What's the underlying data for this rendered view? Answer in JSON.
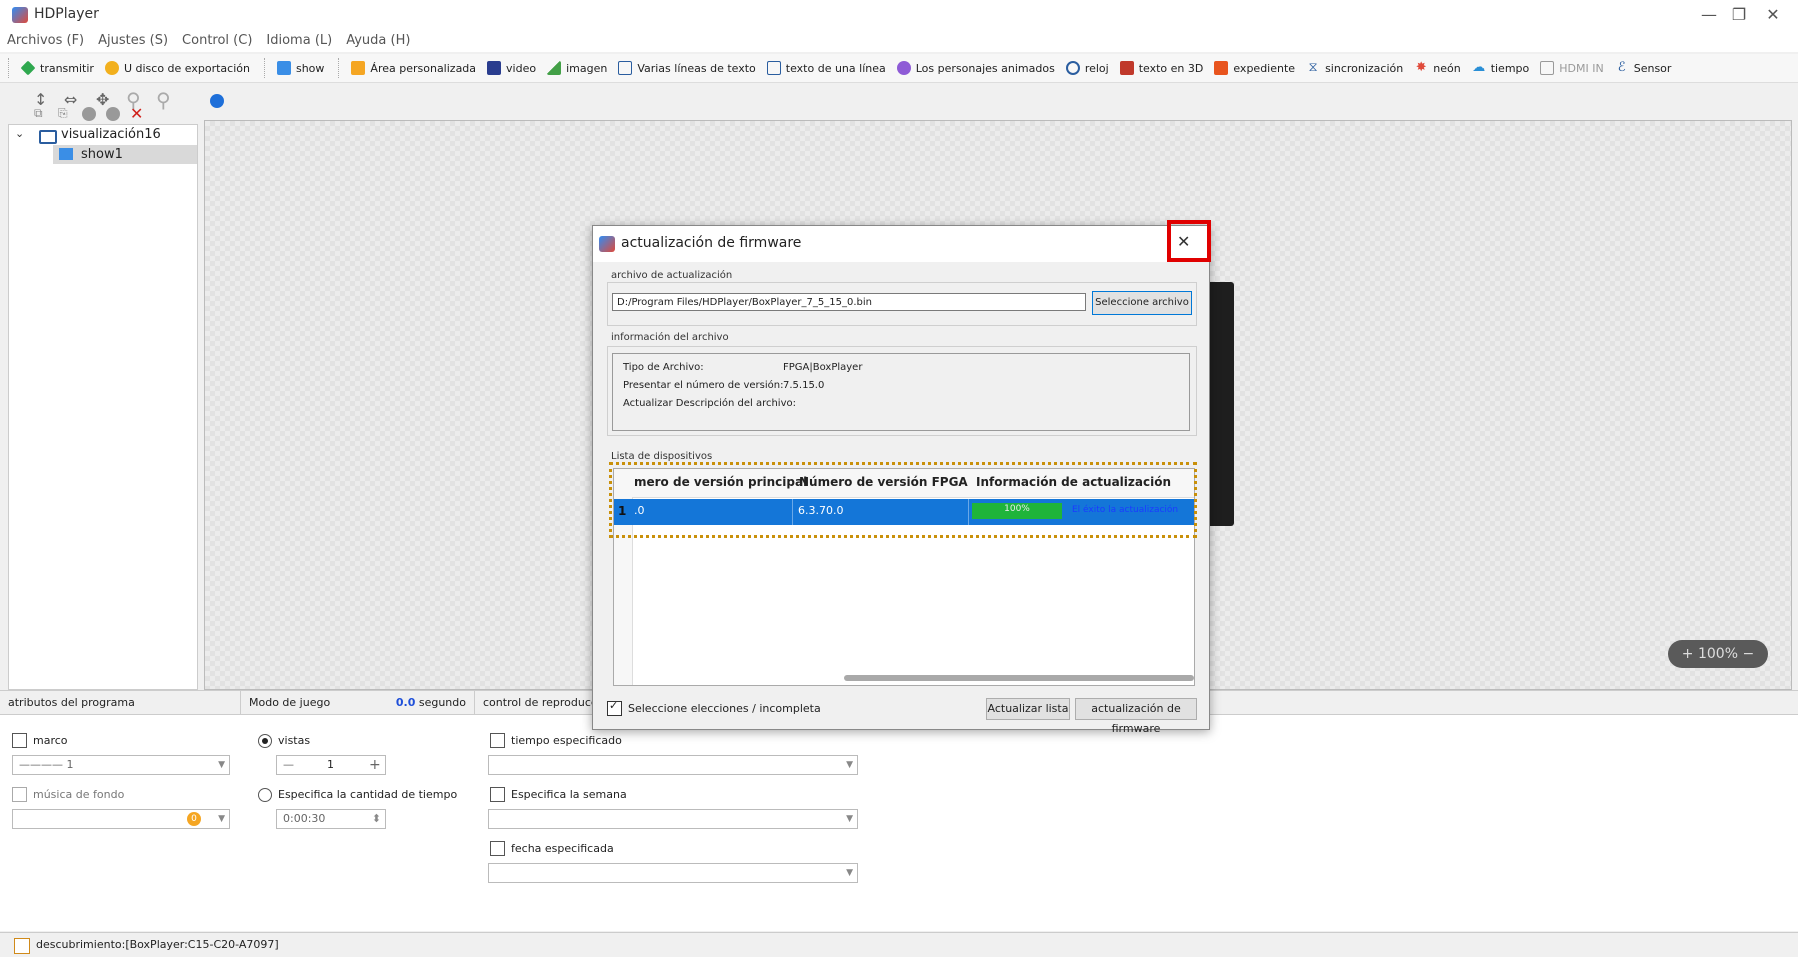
{
  "window": {
    "title": "HDPlayer"
  },
  "menu": [
    "Archivos (F)",
    "Ajustes (S)",
    "Control (C)",
    "Idioma (L)",
    "Ayuda (H)"
  ],
  "toolbar1": {
    "group1": [
      {
        "label": "transmitir",
        "icon": "diamond-icon",
        "color": "#2fa84f"
      },
      {
        "label": "U disco de exportación",
        "icon": "usb-icon",
        "color": "#f2b01e"
      }
    ],
    "group2": [
      {
        "label": "show",
        "icon": "show-icon",
        "color": "#3a8ee6"
      }
    ],
    "group3": [
      {
        "label": "Área personalizada",
        "icon": "area-icon",
        "color": "#f5a623"
      },
      {
        "label": "video",
        "icon": "film-icon",
        "color": "#2a3d8f"
      },
      {
        "label": "imagen",
        "icon": "image-icon",
        "color": "#43a047"
      },
      {
        "label": "Varias líneas de texto",
        "icon": "multiline-text-icon",
        "color": "#2a5d9f"
      },
      {
        "label": "texto de una línea",
        "icon": "singleline-text-icon",
        "color": "#2a5d9f"
      },
      {
        "label": "Los personajes animados",
        "icon": "animated-icon",
        "color": "#8e5bd6"
      },
      {
        "label": "reloj",
        "icon": "clock-icon",
        "color": "#2a5d9f"
      },
      {
        "label": "texto en 3D",
        "icon": "text3d-icon",
        "color": "#c0392b"
      },
      {
        "label": "expediente",
        "icon": "office-icon",
        "color": "#e8541e"
      },
      {
        "label": "sincronización",
        "icon": "hourglass-icon",
        "color": "#2a5d9f"
      },
      {
        "label": "neón",
        "icon": "neon-icon",
        "color": "#e04a3a"
      },
      {
        "label": "tiempo",
        "icon": "weather-icon",
        "color": "#2a8fd6"
      },
      {
        "label": "HDMI IN",
        "icon": "hdmi-icon",
        "color": "#9a9a9a"
      },
      {
        "label": "Sensor",
        "icon": "sensor-icon",
        "color": "#2a5d9f"
      }
    ]
  },
  "tree": {
    "root": "visualización16",
    "child": "show1"
  },
  "zoom": {
    "text": "+ 100% −"
  },
  "panels": {
    "attrs": {
      "header": "atributos del programa",
      "marco": "marco",
      "line_value": "———— 1",
      "music": "música de fondo",
      "music_badge": "0"
    },
    "play_mode": {
      "header": "Modo de juego",
      "seconds_value": "0.0",
      "seconds_unit": "segundo",
      "vistas": "vistas",
      "count": "1",
      "time_amount": "Especifica la cantidad de tiempo",
      "time_value": "0:00:30"
    },
    "playback": {
      "header": "control de reproducción",
      "specified_time": "tiempo especificado",
      "specified_week": "Especifica la semana",
      "specified_date": "fecha especificada"
    }
  },
  "status": {
    "text": "descubrimiento:[BoxPlayer:C15-C20-A7097]"
  },
  "dialog": {
    "title": "actualización de firmware",
    "file_group": "archivo de actualización",
    "file_path": "D:/Program Files/HDPlayer/BoxPlayer_7_5_15_0.bin",
    "select_file": "Seleccione archivo",
    "info_group": "información del archivo",
    "type_label": "Tipo de Archivo:",
    "type_value": "FPGA|BoxPlayer",
    "version_label": "Presentar el número de versión:",
    "version_value": "7.5.15.0",
    "desc_label": "Actualizar Descripción del archivo:",
    "devices_group": "Lista de dispositivos",
    "columns": [
      "mero de versión principal",
      "Número de versión FPGA",
      "Información de actualización"
    ],
    "row": {
      "index": "1",
      "main_version": ".0",
      "fpga_version": "6.3.70.0",
      "progress": 100,
      "progress_text": "100%",
      "info": "El éxito la actualización"
    },
    "select_all": "Seleccione elecciones / incompleta",
    "refresh": "Actualizar lista",
    "upgrade": "actualización de firmware"
  }
}
